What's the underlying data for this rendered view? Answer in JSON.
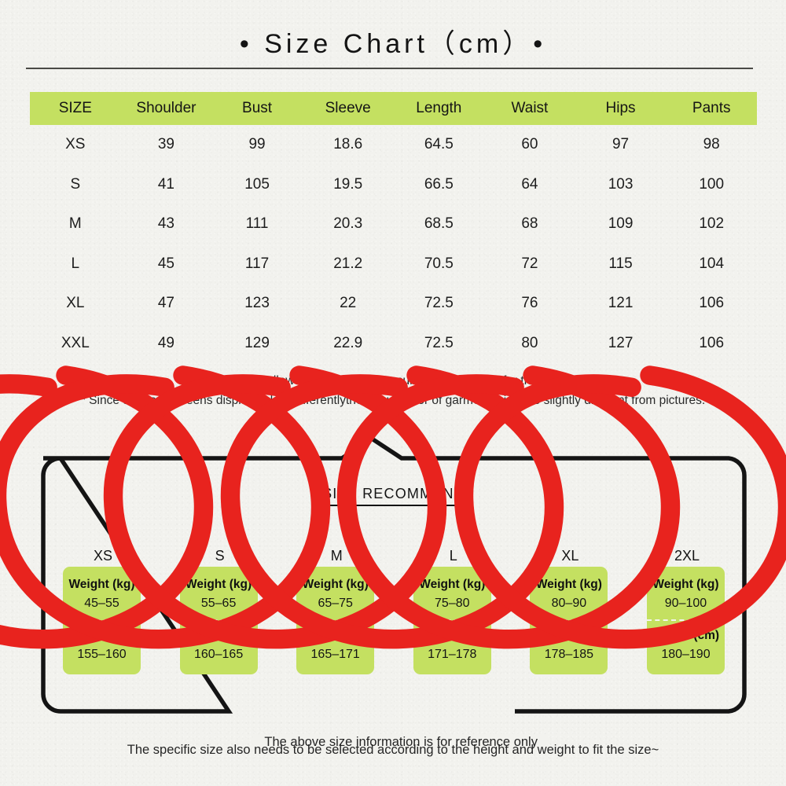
{
  "title": "• Size Chart（cm）•",
  "table": {
    "headers": [
      "SIZE",
      "Shoulder",
      "Bust",
      "Sleeve",
      "Length",
      "Waist",
      "Hips",
      "Pants"
    ],
    "rows": [
      [
        "XS",
        "39",
        "99",
        "18.6",
        "64.5",
        "60",
        "97",
        "98"
      ],
      [
        "S",
        "41",
        "105",
        "19.5",
        "66.5",
        "64",
        "103",
        "100"
      ],
      [
        "M",
        "43",
        "111",
        "20.3",
        "68.5",
        "68",
        "109",
        "102"
      ],
      [
        "L",
        "45",
        "117",
        "21.2",
        "70.5",
        "72",
        "115",
        "104"
      ],
      [
        "XL",
        "47",
        "123",
        "22",
        "72.5",
        "76",
        "121",
        "106"
      ],
      [
        "XXL",
        "49",
        "129",
        "22.9",
        "72.5",
        "80",
        "127",
        "106"
      ]
    ]
  },
  "notes": [
    "* Please allow slight manual measurement deviation for the data.",
    "* Since different screens display colors differentlythe actual color of garment might be slightly different from pictures."
  ],
  "recommend": {
    "heading": "SIZE RECOMMEND",
    "weight_label": "Weight (kg)",
    "height_label": "Height (cm)",
    "cards": [
      {
        "size": "XS",
        "weight": "45–55",
        "height": "155–160"
      },
      {
        "size": "S",
        "weight": "55–65",
        "height": "160–165"
      },
      {
        "size": "M",
        "weight": "65–75",
        "height": "165–171"
      },
      {
        "size": "L",
        "weight": "75–80",
        "height": "171–178"
      },
      {
        "size": "XL",
        "weight": "80–90",
        "height": "178–185"
      },
      {
        "size": "2XL",
        "weight": "90–100",
        "height": "180–190"
      }
    ],
    "footer_line_1": "The above size information is for reference only",
    "footer_line_2": "The specific size also needs to be selected according to the height and weight to fit the size~"
  },
  "colors": {
    "background": "#f2f2ee",
    "green": "#c4e061",
    "circle_red": "#e8231e",
    "ink": "#141414"
  }
}
